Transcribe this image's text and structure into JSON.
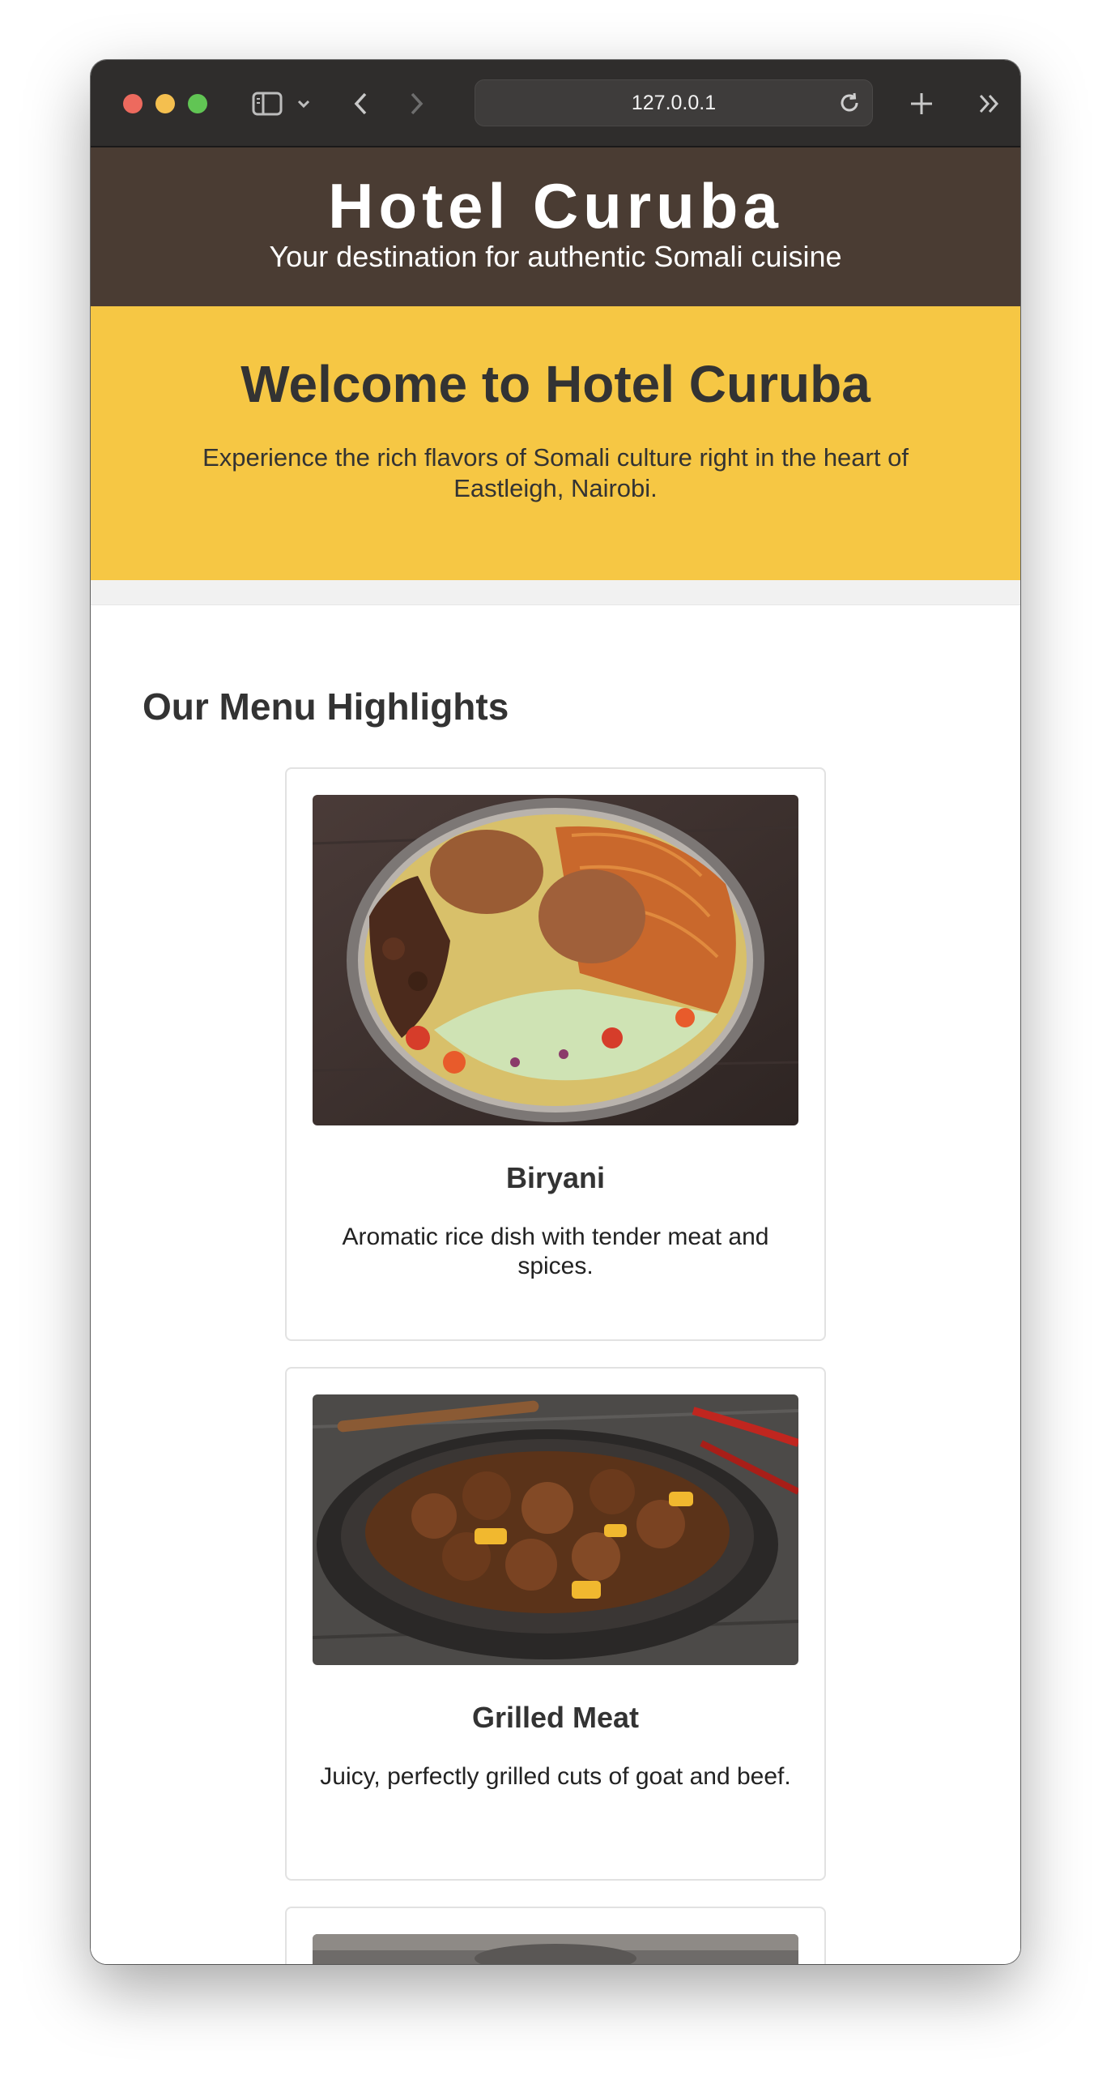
{
  "browser": {
    "url": "127.0.0.1"
  },
  "header": {
    "title": "Hotel Curuba",
    "tagline": "Your destination for authentic Somali cuisine"
  },
  "hero": {
    "heading": "Welcome to Hotel Curuba",
    "text": "Experience the rich flavors of Somali culture right in the heart of Eastleigh, Nairobi."
  },
  "menu": {
    "title": "Our Menu Highlights",
    "items": [
      {
        "name": "Biryani",
        "description": "Aromatic rice dish with tender meat and spices."
      },
      {
        "name": "Grilled Meat",
        "description": "Juicy, perfectly grilled cuts of goat and beef."
      }
    ]
  },
  "colors": {
    "header_bg": "#4a3c33",
    "hero_bg": "#f6c744",
    "text": "#333333"
  }
}
